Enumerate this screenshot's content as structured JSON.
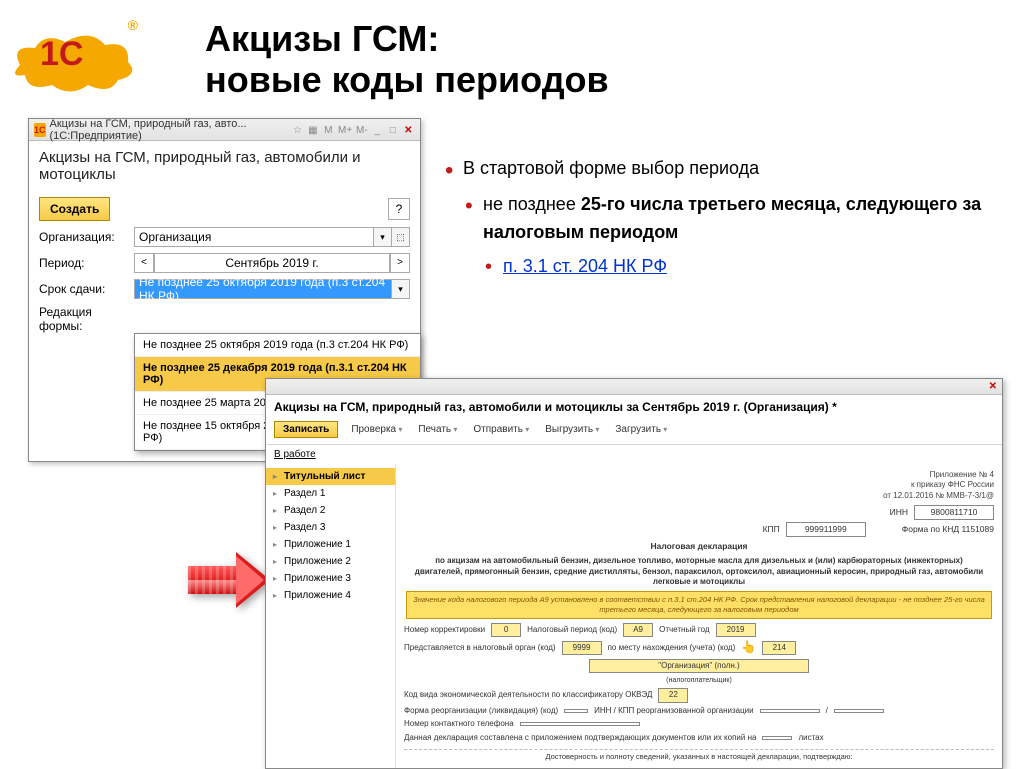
{
  "slide": {
    "title_line1": "Акцизы ГСМ:",
    "title_line2": "новые коды периодов",
    "logo_text": "1С",
    "logo_reg": "®"
  },
  "bullets": {
    "b1": "В стартовой форме выбор периода",
    "b2_pre": "не позднее ",
    "b2_bold": "25-го числа третьего месяца, следующего за налоговым периодом",
    "b3_link": "п. 3.1 ст. 204 НК РФ"
  },
  "win1": {
    "titlebar": "Акцизы на ГСМ, природный газ, авто... (1С:Предприятие)",
    "header": "Акцизы на ГСМ, природный газ, автомобили и мотоциклы",
    "create": "Создать",
    "help": "?",
    "org_label": "Организация:",
    "org_value": "Организация",
    "period_label": "Период:",
    "period_value": "Сентябрь 2019 г.",
    "prev": "<",
    "next": ">",
    "deadline_label": "Срок сдачи:",
    "deadline_value": "Не позднее 25 октября 2019 года (п.3 ст.204 НК РФ)",
    "ver_label": "Редакция формы:",
    "dd": [
      "Не позднее 25 октября 2019 года (п.3 ст.204 НК РФ)",
      "Не позднее 25 декабря 2019 года (п.3.1 ст.204 НК РФ)",
      "Не позднее 25 марта 2020 года (п.3.2 ст.204 НК РФ)",
      "Не позднее 15 октября 2019 года (п.3.3 ст.204 НК РФ)"
    ]
  },
  "win2": {
    "header": "Акцизы на ГСМ, природный газ, автомобили и мотоциклы за Сентябрь 2019 г. (Организация) *",
    "write": "Записать",
    "tb": {
      "check": "Проверка",
      "print": "Печать",
      "send": "Отправить",
      "upload": "Выгрузить",
      "load": "Загрузить"
    },
    "work": "В работе",
    "nav": [
      "Титульный лист",
      "Раздел 1",
      "Раздел 2",
      "Раздел 3",
      "Приложение 1",
      "Приложение 2",
      "Приложение 3",
      "Приложение 4"
    ],
    "appendix_note1": "Приложение № 4",
    "appendix_note2": "к приказу ФНС России",
    "appendix_note3": "от 12.01.2016 № ММВ-7-3/1@",
    "inn_label": "ИНН",
    "inn": "9800811710",
    "kpp_label": "КПП",
    "kpp": "999911999",
    "knd_label": "Форма по КНД 1151089",
    "decl_title": "Налоговая декларация",
    "decl_sub": "по акцизам на автомобильный бензин, дизельное топливо, моторные масла для дизельных и (или) карбюраторных (инжекторных) двигателей, прямогонный бензин, средние дистилляты, бензол, параксилол, ортоксилол, авиационный керосин, природный газ, автомобили легковые и мотоциклы",
    "highlight": "Значение кода налогового периода А9 установлено в соответствии с п.3.1 ст.204 НК РФ. Срок представления налоговой декларации - не позднее 25-го числа третьего месяца, следующего за налоговым периодом",
    "corr_label": "Номер корректировки",
    "corr": "0",
    "taxperiod_label": "Налоговый период (код)",
    "taxperiod": "А9",
    "year_label": "Отчетный год",
    "year": "2019",
    "organ_label": "Представляется в налоговый орган (код)",
    "organ": "9999",
    "place_label": "по месту нахождения (учета) (код)",
    "place": "214",
    "orgfull_label": "\"Организация\" (полн.)",
    "orgfull_sub": "(налогоплательщик)",
    "okved_label": "Код вида экономической деятельности по классификатору ОКВЭД",
    "okved": "22",
    "reorg_label": "Форма реорганизации (ликвидация) (код)",
    "reorg_org_label": "ИНН / КПП реорганизованной организации",
    "phone_label": "Номер контактного телефона",
    "pages_label1": "Данная декларация составлена с приложением подтверждающих документов или их копий на",
    "pages_label2": "листах",
    "confirm": "Достоверность и полноту сведений, указанных в настоящей декларации, подтверждаю:"
  }
}
